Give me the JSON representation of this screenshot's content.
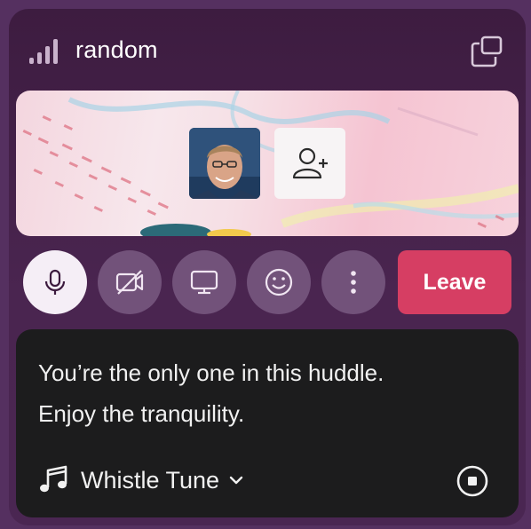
{
  "huddle": {
    "channel_name": "random",
    "icons": {
      "signal": "signal-strength-icon",
      "popout": "popout-window-icon"
    }
  },
  "video": {
    "participant_avatar": "participant-avatar",
    "add_person_icon": "add-person-icon"
  },
  "controls": {
    "buttons": [
      {
        "name": "microphone",
        "icon": "microphone-icon",
        "active": true
      },
      {
        "name": "video-off",
        "icon": "video-off-icon",
        "active": false
      },
      {
        "name": "screen-share",
        "icon": "monitor-icon",
        "active": false
      },
      {
        "name": "reactions",
        "icon": "smiley-icon",
        "active": false
      },
      {
        "name": "more",
        "icon": "more-vertical-icon",
        "active": false
      }
    ],
    "leave_label": "Leave"
  },
  "info": {
    "message_line1": "You’re the only one in this huddle.",
    "message_line2": "Enjoy the tranquility.",
    "tune_label": "Whistle Tune",
    "tune_icon": "music-note-icon",
    "stop_icon": "stop-icon"
  },
  "colors": {
    "panel_bg": "#3d1c40",
    "control_bg": "#72527a",
    "leave_bg": "#d63e63",
    "info_bg": "#1c1c1d"
  }
}
